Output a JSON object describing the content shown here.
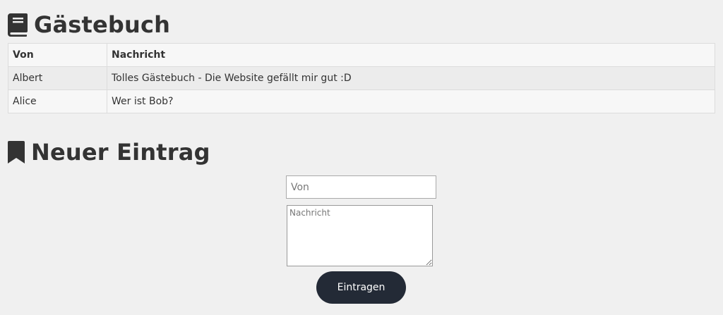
{
  "guestbook": {
    "title": "Gästebuch",
    "icon": "book-icon",
    "columns": [
      "Von",
      "Nachricht"
    ],
    "entries": [
      {
        "from": "Albert",
        "message": "Tolles Gästebuch - Die Website gefällt mir gut :D"
      },
      {
        "from": "Alice",
        "message": "Wer ist Bob?"
      }
    ]
  },
  "new_entry": {
    "title": "Neuer Eintrag",
    "icon": "bookmark-icon",
    "from_placeholder": "Von",
    "message_placeholder": "Nachricht",
    "submit_label": "Eintragen"
  },
  "colors": {
    "background": "#f0f0f0",
    "text": "#333333",
    "button": "#232a36"
  }
}
